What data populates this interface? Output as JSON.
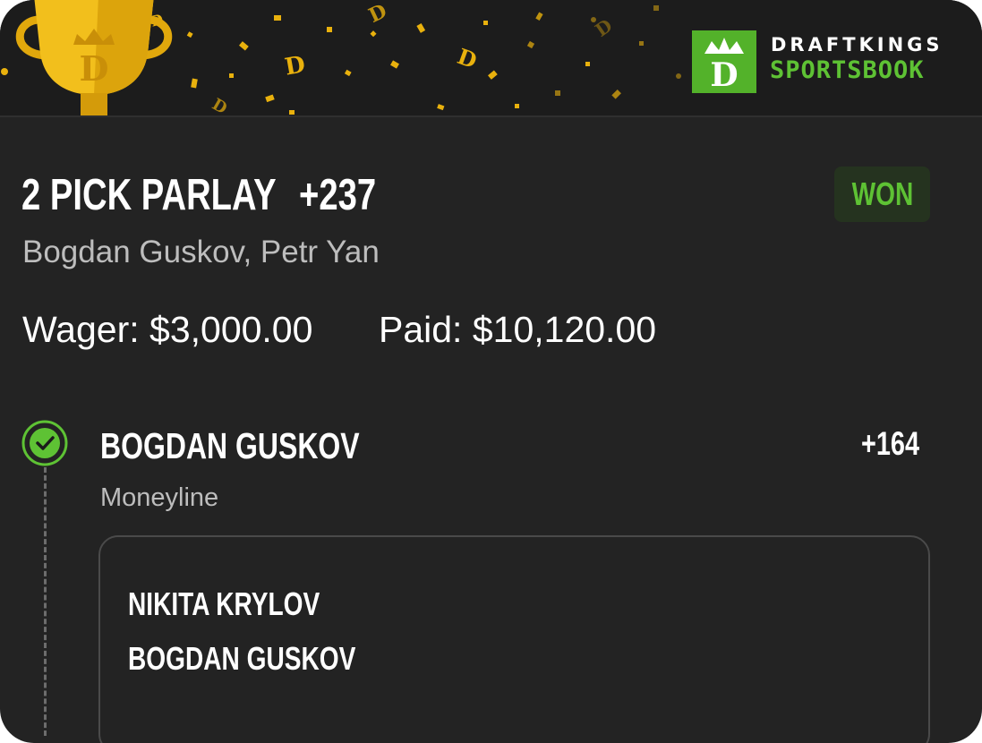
{
  "brand": {
    "line1": "DRAFTKINGS",
    "line2": "SPORTSBOOK",
    "accent_color": "#5ec234",
    "logo_icon": "draftkings-crown-d-icon",
    "trophy_icon": "trophy-icon"
  },
  "bet": {
    "title": "2 PICK PARLAY",
    "odds": "+237",
    "status": "WON",
    "selections_summary": "Bogdan Guskov, Petr Yan",
    "wager_text": "Wager: $3,000.00",
    "paid_text": "Paid: $10,120.00"
  },
  "legs": [
    {
      "selection": "BOGDAN GUSKOV",
      "odds": "+164",
      "market": "Moneyline",
      "status_icon": "check-circle-icon",
      "event": {
        "competitor1": "NIKITA KRYLOV",
        "competitor2": "BOGDAN GUSKOV"
      }
    }
  ],
  "colors": {
    "card_background": "#232323",
    "won_badge_background": "#25331f",
    "won_text": "#5ec234",
    "confetti": "#e9b10d"
  }
}
